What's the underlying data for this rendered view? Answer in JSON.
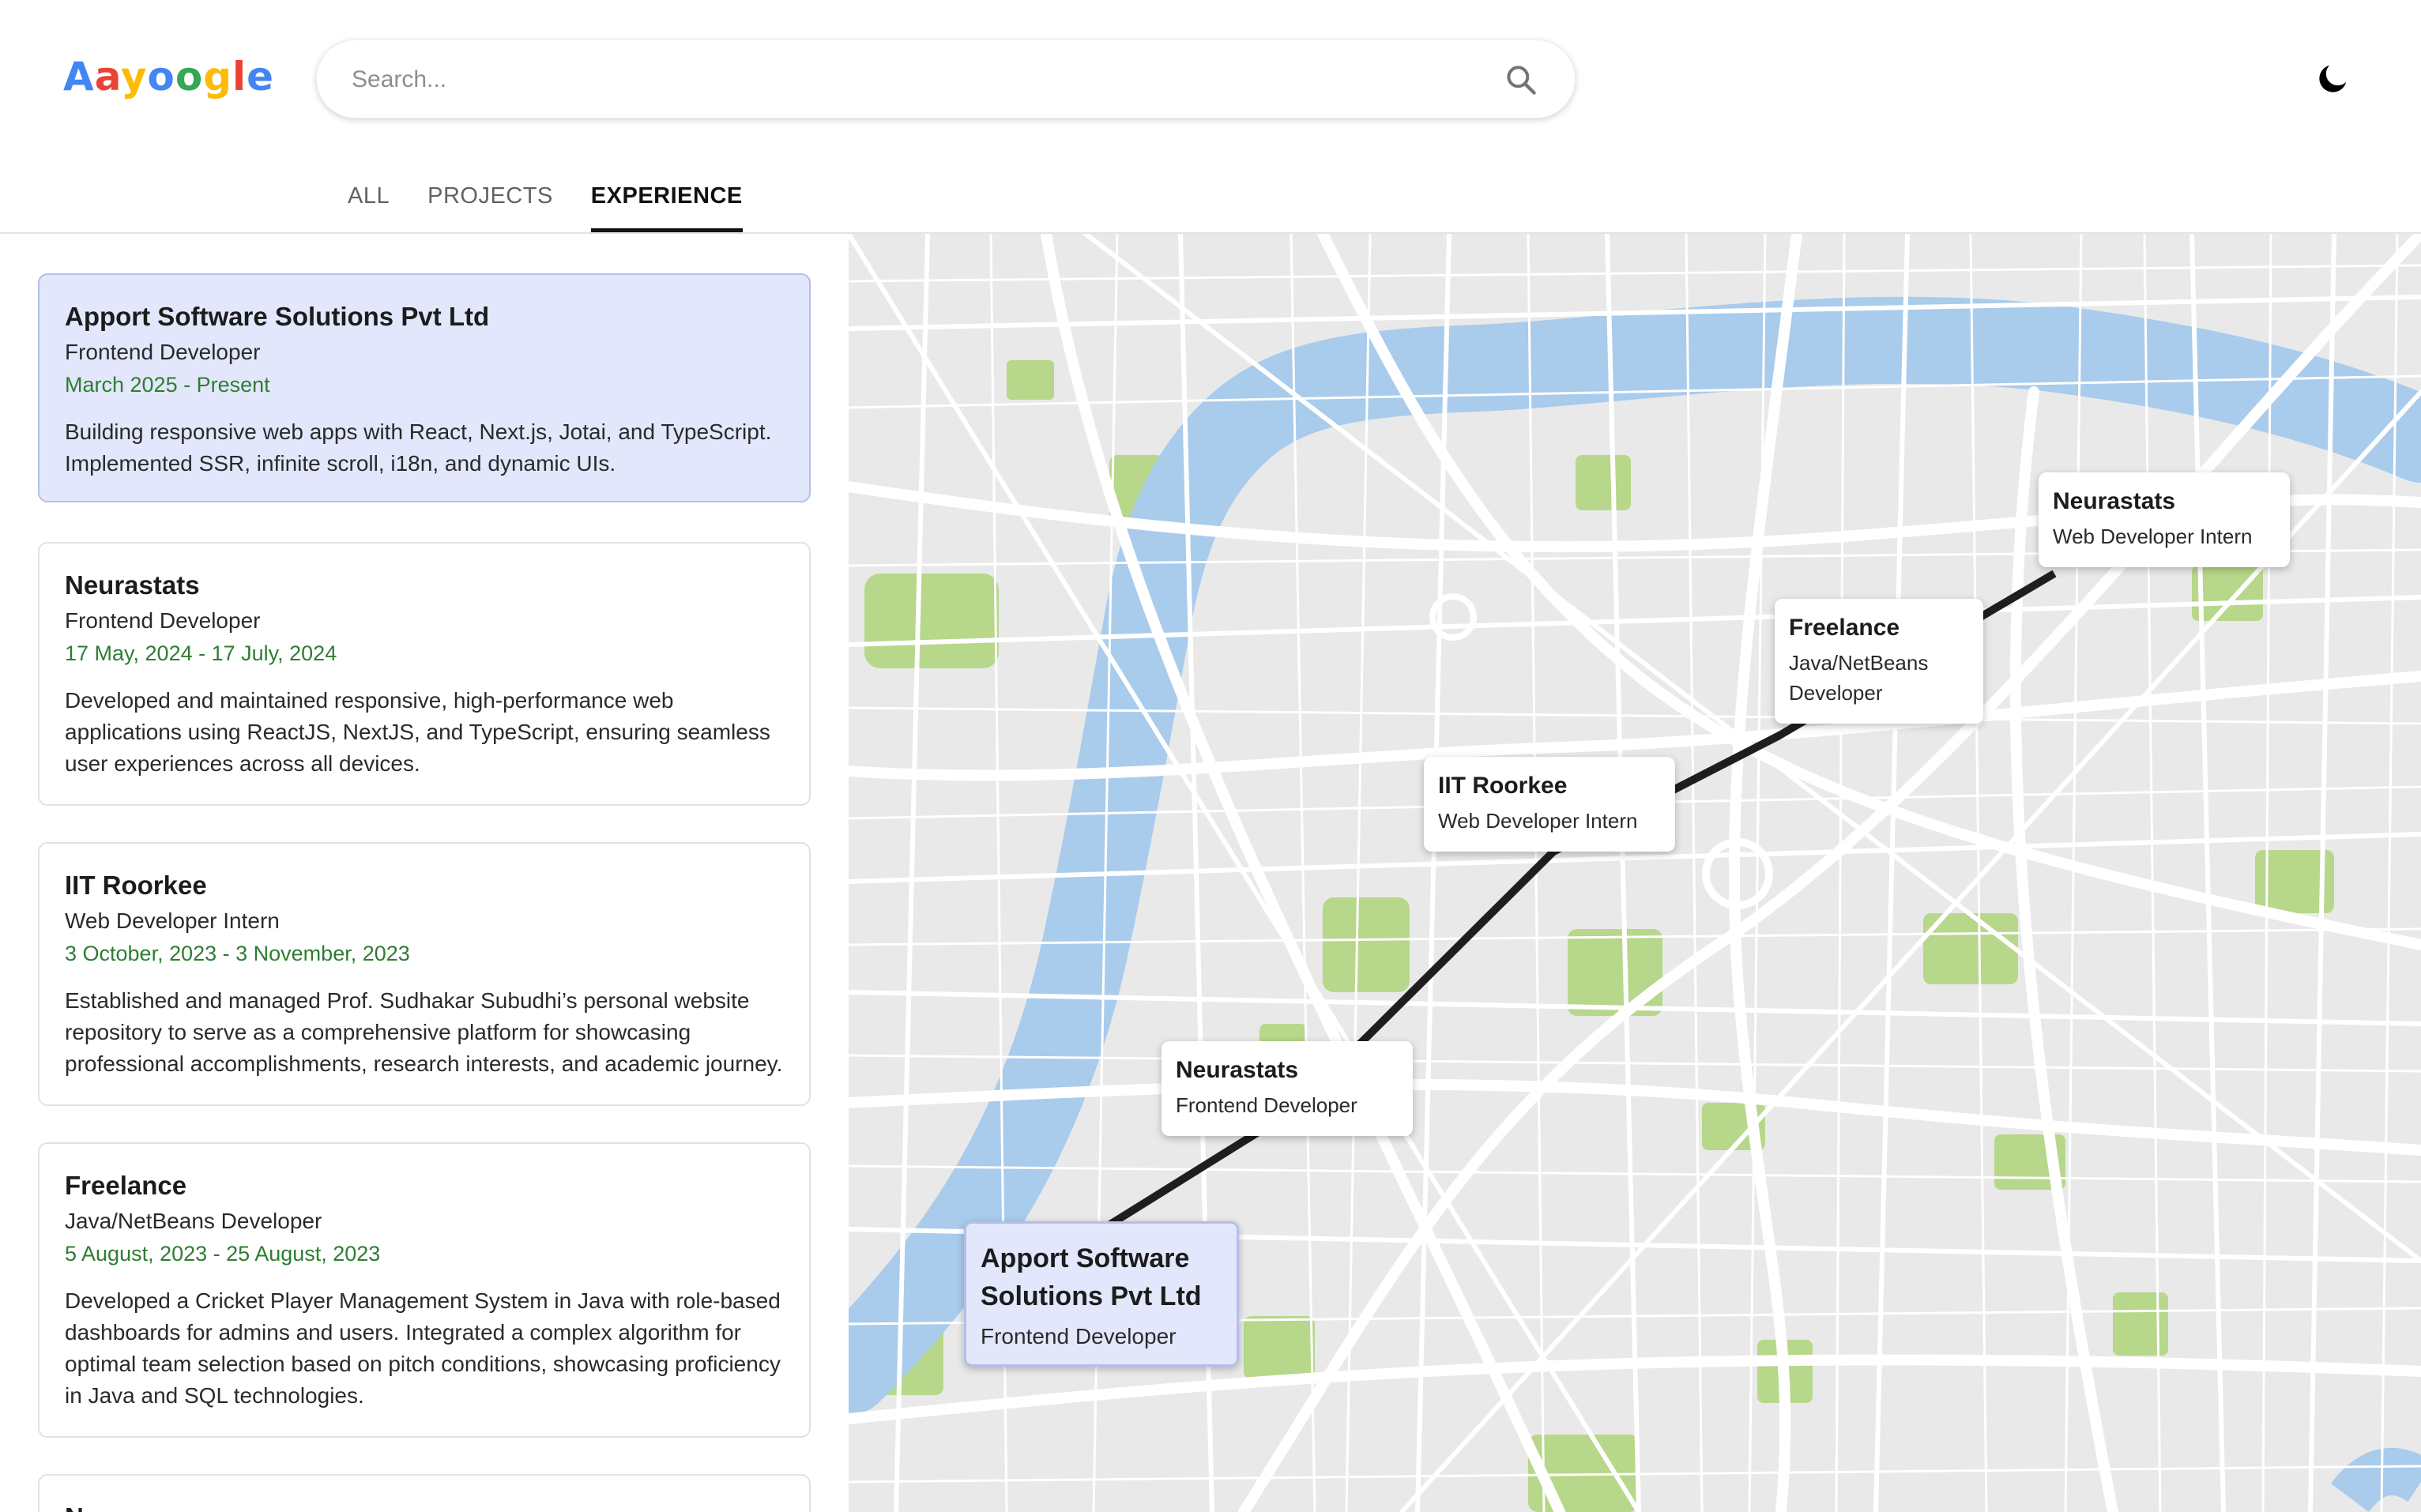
{
  "logo": {
    "letters": [
      "A",
      "a",
      "y",
      "o",
      "o",
      "g",
      "l",
      "e"
    ],
    "colors": [
      "#4285F4",
      "#EA4335",
      "#FBBC05",
      "#4285F4",
      "#34A853",
      "#FBBC05",
      "#EA4335",
      "#4285F4"
    ]
  },
  "search": {
    "placeholder": "Search...",
    "value": ""
  },
  "icons": {
    "search": "search-icon",
    "theme": "moon-icon"
  },
  "tabs": [
    {
      "label": "ALL"
    },
    {
      "label": "PROJECTS"
    },
    {
      "label": "EXPERIENCE"
    }
  ],
  "active_tab": "EXPERIENCE",
  "experience": [
    {
      "company": "Apport Software Solutions Pvt Ltd",
      "role": "Frontend Developer",
      "dates": "March 2025 - Present",
      "description": "Building responsive web apps with React, Next.js, Jotai, and TypeScript. Implemented SSR, infinite scroll, i18n, and dynamic UIs."
    },
    {
      "company": "Neurastats",
      "role": "Frontend Developer",
      "dates": "17 May, 2024 - 17 July, 2024",
      "description": "Developed and maintained responsive, high-performance web applications using ReactJS, NextJS, and TypeScript, ensuring seamless user experiences across all devices."
    },
    {
      "company": "IIT Roorkee",
      "role": "Web Developer Intern",
      "dates": "3 October, 2023 - 3 November, 2023",
      "description": "Established and managed Prof. Sudhakar Subudhi’s personal website repository to serve as a comprehensive platform for showcasing professional accomplishments, research interests, and academic journey."
    },
    {
      "company": "Freelance",
      "role": "Java/NetBeans Developer",
      "dates": "5 August, 2023 - 25 August, 2023",
      "description": "Developed a Cricket Player Management System in Java with role-based dashboards for admins and users. Integrated a complex algorithm for optimal team selection based on pitch conditions, showcasing proficiency in Java and SQL technologies."
    },
    {
      "company": "N",
      "role": "",
      "dates": "",
      "description": ""
    }
  ],
  "map_pins": [
    {
      "title": "Apport Software Solutions Pvt Ltd",
      "role": "Frontend Developer"
    },
    {
      "title": "Neurastats",
      "role": "Frontend Developer"
    },
    {
      "title": "IIT Roorkee",
      "role": "Web Developer Intern"
    },
    {
      "title": "Freelance",
      "role": "Java/NetBeans Developer"
    },
    {
      "title": "Neurastats",
      "role": "Web Developer Intern"
    }
  ],
  "colors": {
    "accent_selected": "#e3e7fb",
    "date_green": "#2e7d32",
    "river": "#a9cbec",
    "park": "#b7d78a",
    "road": "#ffffff",
    "land": "#e9e9e9",
    "route": "#1e1e1e"
  }
}
